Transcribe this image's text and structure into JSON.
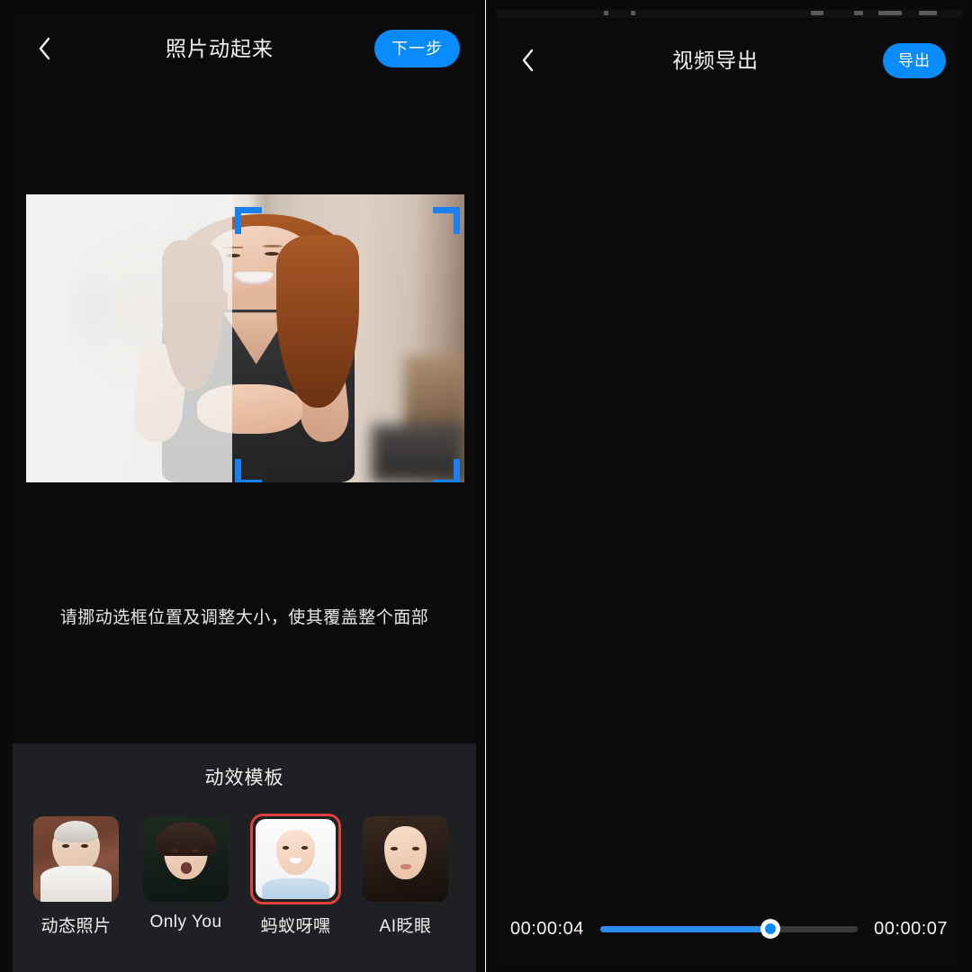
{
  "left_panel": {
    "header": {
      "back_icon": "chevron-left-icon",
      "title": "照片动起来",
      "next_button": "下一步"
    },
    "crop": {
      "hint": "请挪动选框位置及调整大小，使其覆盖整个面部",
      "corner_color": "#1a7ff0"
    },
    "templates": {
      "title": "动效模板",
      "selected_index": 2,
      "selected_border_color": "#e0403c",
      "items": [
        {
          "label": "动态照片",
          "art": "art-a"
        },
        {
          "label": "Only You",
          "art": "art-b"
        },
        {
          "label": "蚂蚁呀嘿",
          "art": "art-c"
        },
        {
          "label": "AI眨眼",
          "art": "art-d"
        }
      ]
    }
  },
  "right_panel": {
    "header": {
      "back_icon": "chevron-left-icon",
      "title": "视频导出",
      "export_button": "导出"
    },
    "player": {
      "play_icon": "play-triangle-icon",
      "current_time": "00:00:04",
      "total_time": "00:00:07",
      "progress_percent": 66,
      "fill_color": "#2b8cf0",
      "track_color": "#3a3a3c",
      "thumb_color": "#ffffff"
    }
  },
  "theme": {
    "accent_blue": "#0a8bfc",
    "background": "#0a0a0a",
    "tray_background": "#1e2023"
  }
}
